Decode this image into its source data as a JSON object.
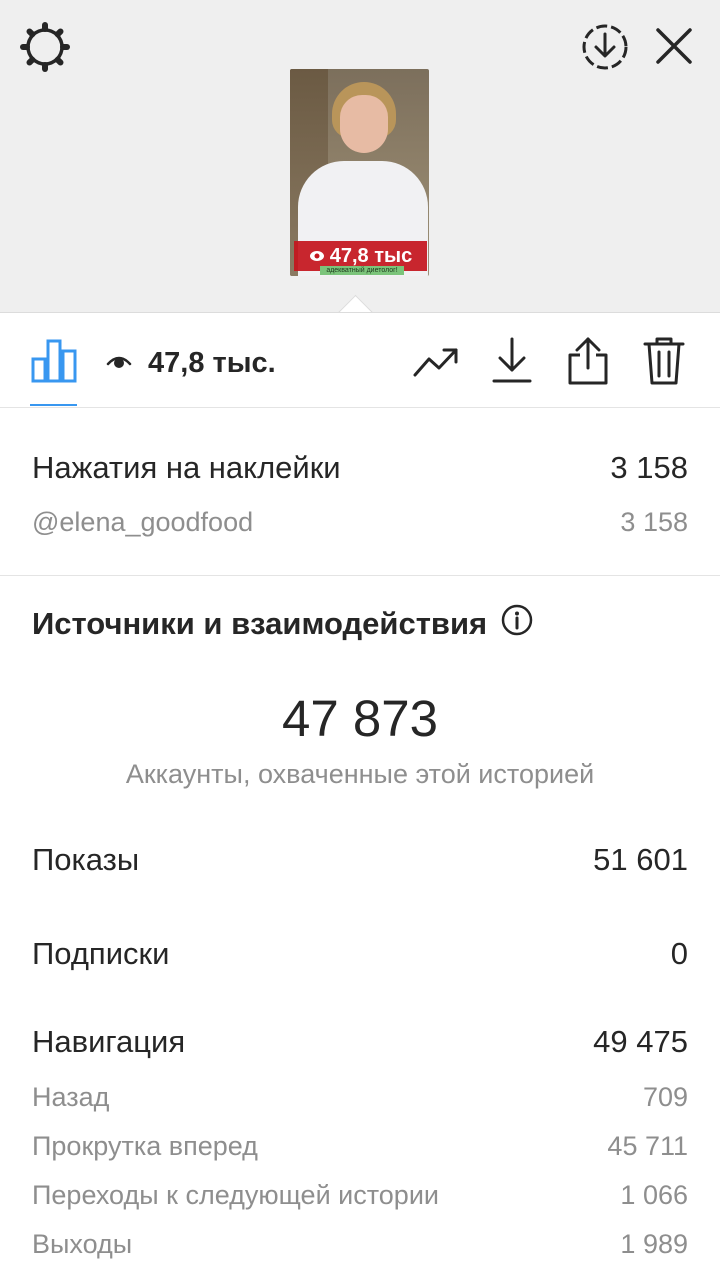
{
  "story": {
    "overlay_views": "47,8 тыс",
    "caption": "адекватный диетолог!"
  },
  "toolbar": {
    "views_count": "47,8 тыс."
  },
  "stickers": {
    "title": "Нажатия на наклейки",
    "total": "3 158",
    "items": [
      {
        "label": "@elena_goodfood",
        "value": "3 158"
      }
    ]
  },
  "sources": {
    "title": "Источники и взаимодействия",
    "reach_value": "47 873",
    "reach_caption": "Аккаунты, охваченные этой историей",
    "impressions": {
      "label": "Показы",
      "value": "51 601"
    },
    "follows": {
      "label": "Подписки",
      "value": "0"
    },
    "navigation": {
      "label": "Навигация",
      "value": "49 475",
      "items": [
        {
          "label": "Назад",
          "value": "709"
        },
        {
          "label": "Прокрутка вперед",
          "value": "45 711"
        },
        {
          "label": "Переходы к следующей истории",
          "value": "1 066"
        },
        {
          "label": "Выходы",
          "value": "1 989"
        }
      ]
    }
  },
  "colors": {
    "accent": "#3897f0",
    "text": "#262626",
    "muted": "#8e8e8e",
    "top_bg": "#efefef"
  },
  "icons": [
    "gear-icon",
    "download-circle-icon",
    "close-icon",
    "bar-chart-icon",
    "eye-icon",
    "trend-icon",
    "download-icon",
    "share-icon",
    "trash-icon",
    "info-icon"
  ]
}
